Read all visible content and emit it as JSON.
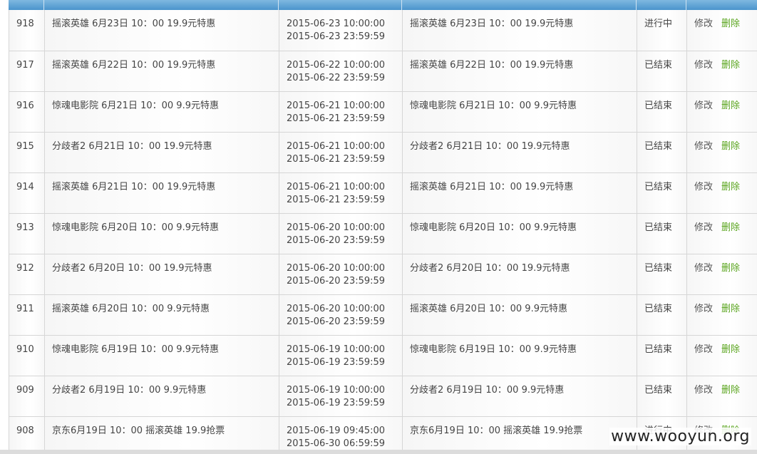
{
  "rows": [
    {
      "id": "918",
      "title": "摇滚英雄 6月23日 10：00 19.9元特惠",
      "start": "2015-06-23 10:00:00",
      "end": "2015-06-23 23:59:59",
      "desc": "摇滚英雄 6月23日 10：00 19.9元特惠",
      "status": "进行中",
      "edit": "修改",
      "del": "删除"
    },
    {
      "id": "917",
      "title": "摇滚英雄 6月22日 10：00 19.9元特惠",
      "start": "2015-06-22 10:00:00",
      "end": "2015-06-22 23:59:59",
      "desc": "摇滚英雄 6月22日 10：00 19.9元特惠",
      "status": "已结束",
      "edit": "修改",
      "del": "删除"
    },
    {
      "id": "916",
      "title": "惊魂电影院 6月21日 10：00 9.9元特惠",
      "start": "2015-06-21 10:00:00",
      "end": "2015-06-21 23:59:59",
      "desc": "惊魂电影院 6月21日 10：00 9.9元特惠",
      "status": "已结束",
      "edit": "修改",
      "del": "删除"
    },
    {
      "id": "915",
      "title": "分歧者2 6月21日 10：00 19.9元特惠",
      "start": "2015-06-21 10:00:00",
      "end": "2015-06-21 23:59:59",
      "desc": "分歧者2 6月21日 10：00 19.9元特惠",
      "status": "已结束",
      "edit": "修改",
      "del": "删除"
    },
    {
      "id": "914",
      "title": "摇滚英雄 6月21日 10：00 19.9元特惠",
      "start": "2015-06-21 10:00:00",
      "end": "2015-06-21 23:59:59",
      "desc": "摇滚英雄 6月21日 10：00 19.9元特惠",
      "status": "已结束",
      "edit": "修改",
      "del": "删除"
    },
    {
      "id": "913",
      "title": "惊魂电影院 6月20日 10：00 9.9元特惠",
      "start": "2015-06-20 10:00:00",
      "end": "2015-06-20 23:59:59",
      "desc": "惊魂电影院 6月20日 10：00 9.9元特惠",
      "status": "已结束",
      "edit": "修改",
      "del": "删除"
    },
    {
      "id": "912",
      "title": "分歧者2 6月20日 10：00 19.9元特惠",
      "start": "2015-06-20 10:00:00",
      "end": "2015-06-20 23:59:59",
      "desc": "分歧者2 6月20日 10：00 19.9元特惠",
      "status": "已结束",
      "edit": "修改",
      "del": "删除"
    },
    {
      "id": "911",
      "title": "摇滚英雄 6月20日 10：00 9.9元特惠",
      "start": "2015-06-20 10:00:00",
      "end": "2015-06-20 23:59:59",
      "desc": "摇滚英雄 6月20日 10：00 9.9元特惠",
      "status": "已结束",
      "edit": "修改",
      "del": "删除"
    },
    {
      "id": "910",
      "title": "惊魂电影院 6月19日 10：00 9.9元特惠",
      "start": "2015-06-19 10:00:00",
      "end": "2015-06-19 23:59:59",
      "desc": "惊魂电影院 6月19日 10：00 9.9元特惠",
      "status": "已结束",
      "edit": "修改",
      "del": "删除"
    },
    {
      "id": "909",
      "title": "分歧者2 6月19日 10：00 9.9元特惠",
      "start": "2015-06-19 10:00:00",
      "end": "2015-06-19 23:59:59",
      "desc": "分歧者2 6月19日 10：00 9.9元特惠",
      "status": "已结束",
      "edit": "修改",
      "del": "删除"
    },
    {
      "id": "908",
      "title": "京东6月19日 10：00 摇滚英雄 19.9抢票",
      "start": "2015-06-19 09:45:00",
      "end": "2015-06-30 06:59:59",
      "desc": "京东6月19日 10：00 摇滚英雄 19.9抢票",
      "status": "进行中",
      "edit": "修改",
      "del": "删除"
    }
  ],
  "watermark": "www.wooyun.org",
  "colors": {
    "header": "#4a94cc",
    "delete_link": "#5aa51e"
  }
}
